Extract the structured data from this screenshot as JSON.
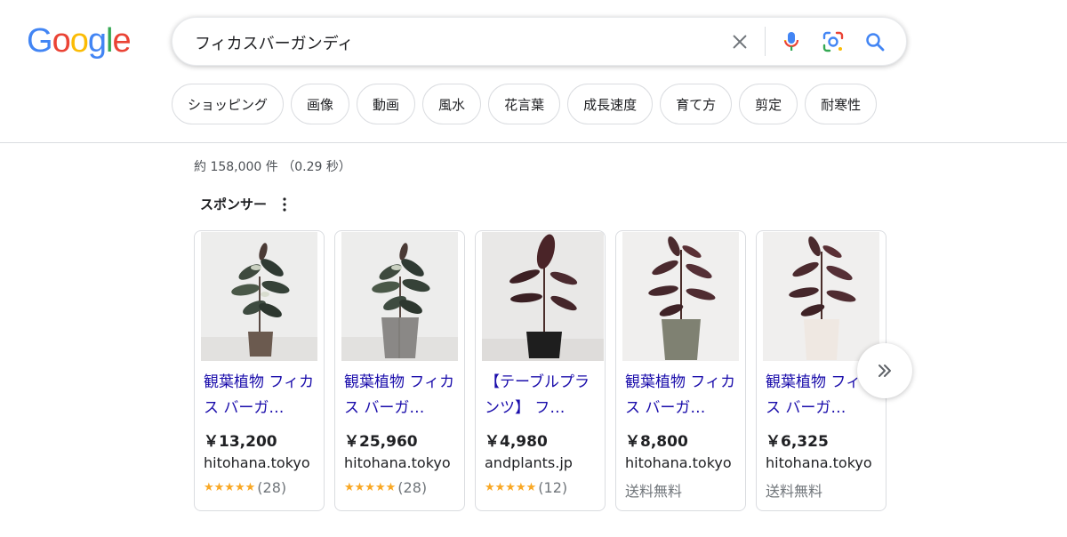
{
  "logo": {
    "letters": [
      "G",
      "o",
      "o",
      "g",
      "l",
      "e"
    ],
    "colors": [
      "#4285F4",
      "#EA4335",
      "#FBBC05",
      "#4285F4",
      "#34A853",
      "#EA4335"
    ]
  },
  "search": {
    "query": "フィカスバーガンディ"
  },
  "chips": [
    "ショッピング",
    "画像",
    "動画",
    "風水",
    "花言葉",
    "成長速度",
    "育て方",
    "剪定",
    "耐寒性"
  ],
  "result_stats": "約 158,000 件 （0.29 秒）",
  "sponsor_label": "スポンサー",
  "products": [
    {
      "title": "観葉植物 フィカス バーガ…",
      "price": "￥13,200",
      "store": "hitohana.tokyo",
      "stars": "★★★★★",
      "rating": 4.5,
      "reviews": "(28)",
      "pot_color": "#6b5a4f"
    },
    {
      "title": "観葉植物 フィカス バーガ…",
      "price": "￥25,960",
      "store": "hitohana.tokyo",
      "stars": "★★★★★",
      "rating": 4.5,
      "reviews": "(28)",
      "pot_color": "#8a8886"
    },
    {
      "title": "【テーブルプランツ】 フ…",
      "price": "￥4,980",
      "store": "andplants.jp",
      "stars": "★★★★★",
      "rating": 5,
      "reviews": "(12)",
      "pot_color": "#1e1e1e"
    },
    {
      "title": "観葉植物 フィカス バーガ…",
      "price": "￥8,800",
      "store": "hitohana.tokyo",
      "shipping": "送料無料",
      "pot_color": "#7f8172"
    },
    {
      "title": "観葉植物 フィカス バーガ…",
      "price": "￥6,325",
      "store": "hitohana.tokyo",
      "shipping": "送料無料",
      "pot_color": "#efe8e2"
    }
  ],
  "icons": {
    "clear": "close-icon",
    "mic": "microphone-icon",
    "lens": "camera-lens-icon",
    "search": "search-icon",
    "next": "chevron-double-right-icon",
    "more": "more-vert-icon"
  }
}
